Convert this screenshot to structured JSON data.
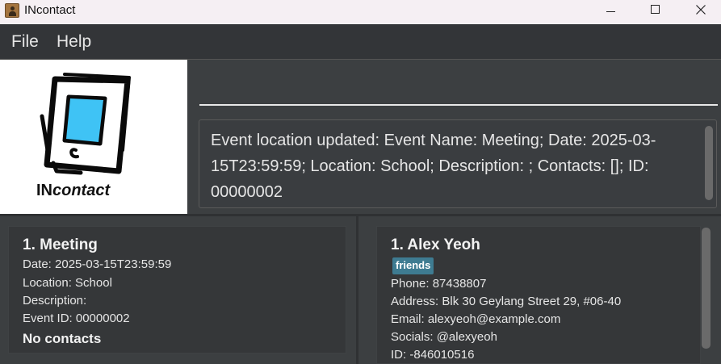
{
  "window": {
    "title": "INcontact"
  },
  "menu": {
    "file": "File",
    "help": "Help"
  },
  "logo": {
    "brand_prefix": "IN",
    "brand_suffix": "contact"
  },
  "command": {
    "value": "",
    "placeholder": ""
  },
  "result": {
    "message": "Event location updated: Event Name: Meeting; Date: 2025-03-15T23:59:59; Location: School; Description: ; Contacts: []; ID: 00000002"
  },
  "events": [
    {
      "title": "1.  Meeting",
      "date": "Date: 2025-03-15T23:59:59",
      "location": "Location: School",
      "description": "Description:",
      "event_id": "Event ID: 00000002",
      "contacts": "No contacts"
    }
  ],
  "contacts": [
    {
      "title": "1. Alex Yeoh",
      "tag": "friends",
      "phone": "Phone: 87438807",
      "address": "Address: Blk 30 Geylang Street 29, #06-40",
      "email": "Email: alexyeoh@example.com",
      "socials": "Socials: @alexyeoh",
      "id": "ID: -846010516"
    }
  ],
  "colors": {
    "tag_bg": "#3e7b91",
    "logo_screen": "#3fc3f5",
    "panel_bg": "#3c3f41",
    "card_bg": "#353739"
  },
  "icons": {
    "app": "contact-card-icon",
    "minimize": "minimize-icon",
    "maximize": "maximize-icon",
    "close": "close-icon"
  }
}
